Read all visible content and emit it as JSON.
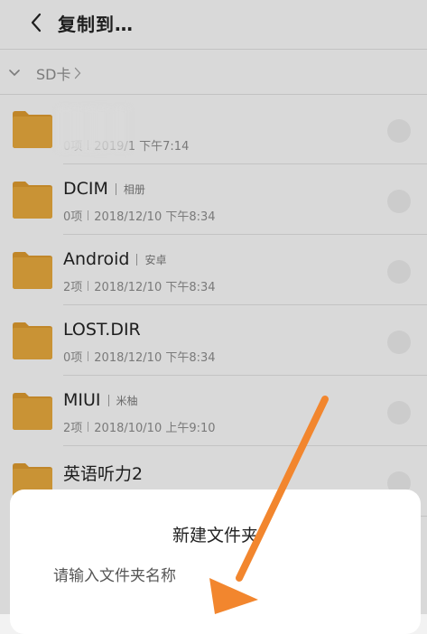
{
  "header": {
    "title": "复制到…"
  },
  "breadcrumb": {
    "location": "SD卡"
  },
  "files": [
    {
      "name": "",
      "tag": "",
      "count": "0项",
      "date": "2019/1 下午7:14",
      "blurred": true
    },
    {
      "name": "DCIM",
      "tag": "相册",
      "count": "0项",
      "date": "2018/12/10 下午8:34"
    },
    {
      "name": "Android",
      "tag": "安卓",
      "count": "2项",
      "date": "2018/12/10 下午8:34"
    },
    {
      "name": "LOST.DIR",
      "tag": "",
      "count": "0项",
      "date": "2018/12/10 下午8:34"
    },
    {
      "name": "MIUI",
      "tag": "米柚",
      "count": "2项",
      "date": "2018/10/10 上午9:10"
    },
    {
      "name": "英语听力2",
      "tag": "",
      "count": "",
      "date": ""
    }
  ],
  "dialog": {
    "title": "新建文件夹",
    "input_placeholder": "请输入文件夹名称",
    "input_value": ""
  },
  "colors": {
    "background": "#f2f2f2",
    "folder": "#e0a43c",
    "folder_tab": "#d6962e",
    "annotation_arrow": "#f2862e"
  },
  "icons": {
    "back": "chevron-left-icon",
    "expand": "chevron-down-icon",
    "breadcrumb_arrow": "chevron-right-icon",
    "folder": "folder-icon",
    "select": "radio-circle-icon"
  }
}
